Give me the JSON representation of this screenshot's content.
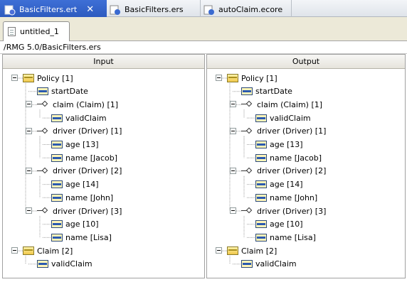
{
  "editor_tabs": [
    {
      "label": "BasicFilters.ert",
      "active": true,
      "closable": true,
      "icon": "ert-file-icon"
    },
    {
      "label": "BasicFilters.ers",
      "active": false,
      "icon": "ers-file-icon"
    },
    {
      "label": "autoClaim.ecore",
      "active": false,
      "icon": "ecore-file-icon"
    }
  ],
  "sub_tab": {
    "label": "untitled_1",
    "icon": "document-icon"
  },
  "path": "/RMG 5.0/BasicFilters.ers",
  "panels": {
    "input": {
      "header": "Input"
    },
    "output": {
      "header": "Output"
    }
  },
  "tree": [
    {
      "label": "Policy [1]",
      "icon": "folder",
      "depth": 0,
      "expandable": true
    },
    {
      "label": "startDate",
      "icon": "attribute",
      "depth": 1
    },
    {
      "label": "claim (Claim) [1]",
      "icon": "reference",
      "depth": 1,
      "expandable": true
    },
    {
      "label": "validClaim",
      "icon": "attribute",
      "depth": 2
    },
    {
      "label": "driver (Driver) [1]",
      "icon": "reference",
      "depth": 1,
      "expandable": true
    },
    {
      "label": "age [13]",
      "icon": "attribute",
      "depth": 2
    },
    {
      "label": "name [Jacob]",
      "icon": "attribute",
      "depth": 2
    },
    {
      "label": "driver (Driver) [2]",
      "icon": "reference",
      "depth": 1,
      "expandable": true
    },
    {
      "label": "age [14]",
      "icon": "attribute",
      "depth": 2
    },
    {
      "label": "name [John]",
      "icon": "attribute",
      "depth": 2
    },
    {
      "label": "driver (Driver) [3]",
      "icon": "reference",
      "depth": 1,
      "expandable": true
    },
    {
      "label": "age [10]",
      "icon": "attribute",
      "depth": 2
    },
    {
      "label": "name [Lisa]",
      "icon": "attribute",
      "depth": 2
    },
    {
      "label": "Claim [2]",
      "icon": "folder",
      "depth": 0,
      "expandable": true
    },
    {
      "label": "validClaim",
      "icon": "attribute",
      "depth": 1
    }
  ],
  "colors": {
    "active_tab": "#2d5bbf",
    "tab_bar": "#dfe4ea",
    "attr_icon": "#2a5ab0",
    "folder_icon": "#f0c84a"
  }
}
